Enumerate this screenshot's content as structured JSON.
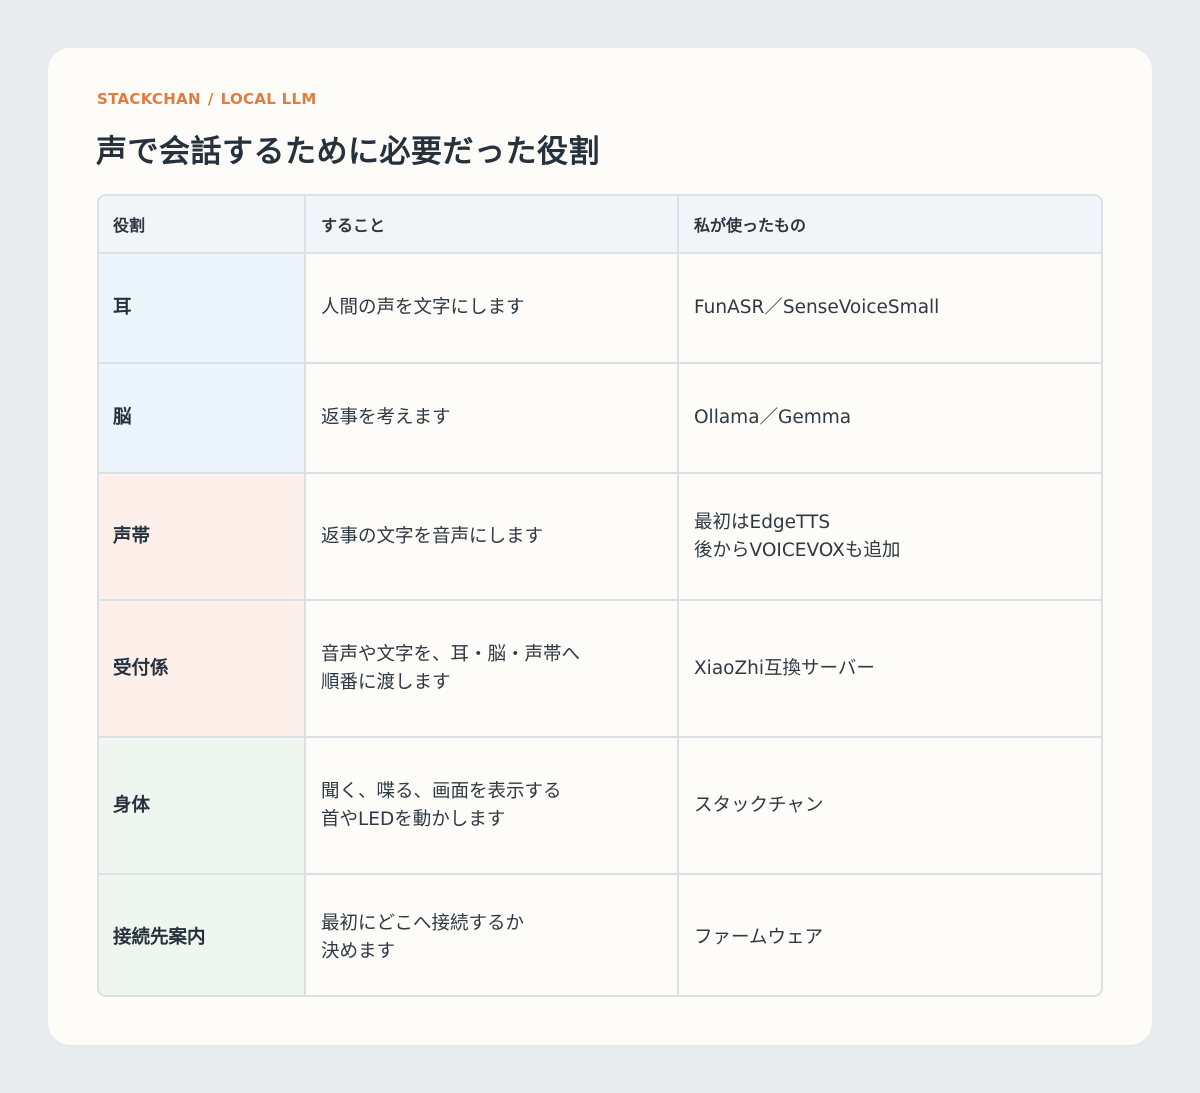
{
  "header": {
    "crumb_project": "STACKCHAN",
    "crumb_separator": "/",
    "crumb_topic": "LOCAL LLM",
    "title": "声で会話するために必要だった役割"
  },
  "table": {
    "columns": [
      "役割",
      "すること",
      "私が使ったもの"
    ],
    "rows": [
      {
        "role": "耳",
        "role_color": "#ecf5fc",
        "task_lines": [
          "人間の声を文字にします"
        ],
        "tool_lines": [
          "FunASR／SenseVoiceSmall"
        ]
      },
      {
        "role": "脳",
        "role_color": "#ecf5fc",
        "task_lines": [
          "返事を考えます"
        ],
        "tool_lines": [
          "Ollama／Gemma"
        ]
      },
      {
        "role": "声帯",
        "role_color": "#fdf0ea",
        "task_lines": [
          "返事の文字を音声にします"
        ],
        "tool_lines": [
          "最初はEdgeTTS",
          "後からVOICEVOXも追加"
        ]
      },
      {
        "role": "受付係",
        "role_color": "#fdf0ea",
        "task_lines": [
          "音声や文字を、耳・脳・声帯へ",
          "順番に渡します"
        ],
        "tool_lines": [
          "XiaoZhi互換サーバー"
        ]
      },
      {
        "role": "身体",
        "role_color": "#eff5ef",
        "task_lines": [
          "聞く、喋る、画面を表示する",
          "首やLEDを動かします"
        ],
        "tool_lines": [
          "スタックチャン"
        ]
      },
      {
        "role": "接続先案内",
        "role_color": "#eff5ef",
        "task_lines": [
          "最初にどこへ接続するか",
          "決めます"
        ],
        "tool_lines": [
          "ファームウェア"
        ]
      }
    ]
  },
  "colors": {
    "accent": "#dd7d42",
    "card_background": "#fdfcf8",
    "page_background": "#e8ecee",
    "table_header": "#f2f5f8",
    "border": "#d9e1e7"
  }
}
